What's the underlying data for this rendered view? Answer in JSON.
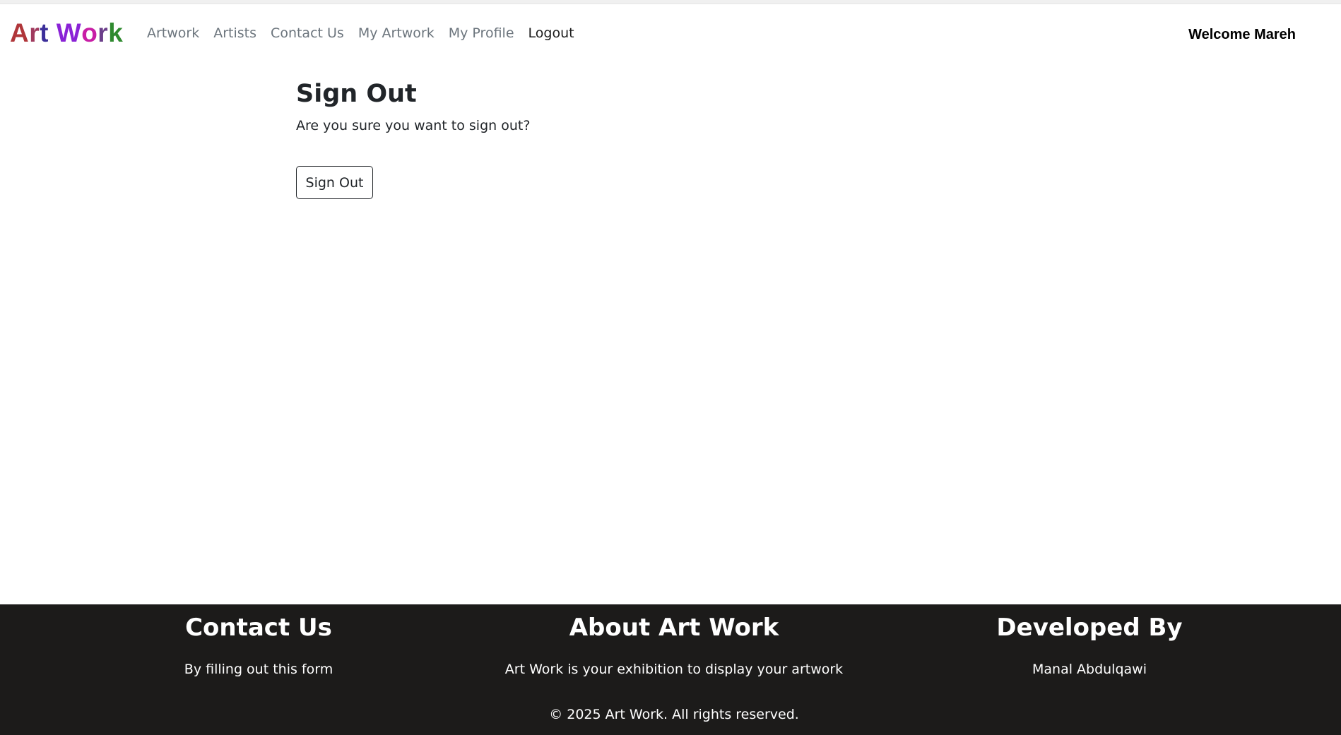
{
  "brand": {
    "letters": [
      {
        "char": "A",
        "color": "#b0363a"
      },
      {
        "char": "r",
        "color": "#a03a5e"
      },
      {
        "char": "t",
        "color": "#3c2f9a"
      },
      {
        "char": " ",
        "color": "#000000"
      },
      {
        "char": "W",
        "color": "#8a22d6"
      },
      {
        "char": "o",
        "color": "#c81ea6"
      },
      {
        "char": "r",
        "color": "#6b3f8a"
      },
      {
        "char": "k",
        "color": "#2f8a2f"
      }
    ]
  },
  "nav": {
    "items": [
      {
        "label": "Artwork",
        "active": false
      },
      {
        "label": "Artists",
        "active": false
      },
      {
        "label": "Contact Us",
        "active": false
      },
      {
        "label": "My Artwork",
        "active": false
      },
      {
        "label": "My Profile",
        "active": false
      },
      {
        "label": "Logout",
        "active": true
      }
    ],
    "welcome": "Welcome Mareh"
  },
  "main": {
    "title": "Sign Out",
    "subtitle": "Are you sure you want to sign out?",
    "button_label": "Sign Out"
  },
  "footer": {
    "columns": [
      {
        "heading": "Contact Us",
        "text": "By filling out this form"
      },
      {
        "heading": "About Art Work",
        "text": "Art Work is your exhibition to display your artwork"
      },
      {
        "heading": "Developed By",
        "text": "Manal Abdulqawi"
      }
    ],
    "copyright": "© 2025 Art Work. All rights reserved."
  },
  "colors": {
    "footer_bg": "#1c1b1a",
    "nav_link": "#6c757d",
    "nav_active": "#1b1b1b"
  }
}
